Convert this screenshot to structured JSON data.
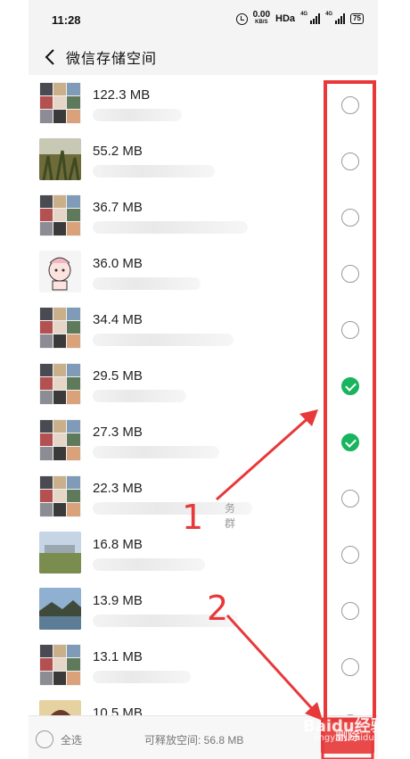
{
  "status_bar": {
    "time": "11:28",
    "net_speed_value": "0.00",
    "net_speed_unit": "KB/S",
    "hd_label": "HDa",
    "signal_1_label": "4G",
    "signal_2_label": "4G",
    "battery_level": "75"
  },
  "header": {
    "title": "微信存储空间",
    "back_icon": "chevron-left-icon"
  },
  "items": [
    {
      "size": "122.3 MB",
      "selected": false,
      "thumb": "collage"
    },
    {
      "size": "55.2 MB",
      "selected": false,
      "thumb": "plants"
    },
    {
      "size": "36.7 MB",
      "selected": false,
      "thumb": "collage"
    },
    {
      "size": "36.0 MB",
      "selected": false,
      "thumb": "cartoon"
    },
    {
      "size": "34.4 MB",
      "selected": false,
      "thumb": "collage"
    },
    {
      "size": "29.5 MB",
      "selected": true,
      "thumb": "collage"
    },
    {
      "size": "27.3 MB",
      "selected": true,
      "thumb": "collage"
    },
    {
      "size": "22.3 MB",
      "selected": false,
      "thumb": "collage",
      "name_tail": "务群"
    },
    {
      "size": "16.8 MB",
      "selected": false,
      "thumb": "landscape"
    },
    {
      "size": "13.9 MB",
      "selected": false,
      "thumb": "lake"
    },
    {
      "size": "13.1 MB",
      "selected": false,
      "thumb": "collage"
    },
    {
      "size": "10.5 MB",
      "selected": false,
      "thumb": "portrait"
    }
  ],
  "footer": {
    "select_all_label": "全选",
    "freeable_label": "可释放空间: 56.8 MB",
    "delete_label": "删除"
  },
  "annotations": {
    "label_1": "1",
    "label_2": "2",
    "color": "#e8383a"
  },
  "watermark": {
    "text": "Baidu经验",
    "sub": "jingyan.baidu.com"
  },
  "colors": {
    "accent_green": "#18b45e",
    "delete_red": "#e84a4a"
  }
}
